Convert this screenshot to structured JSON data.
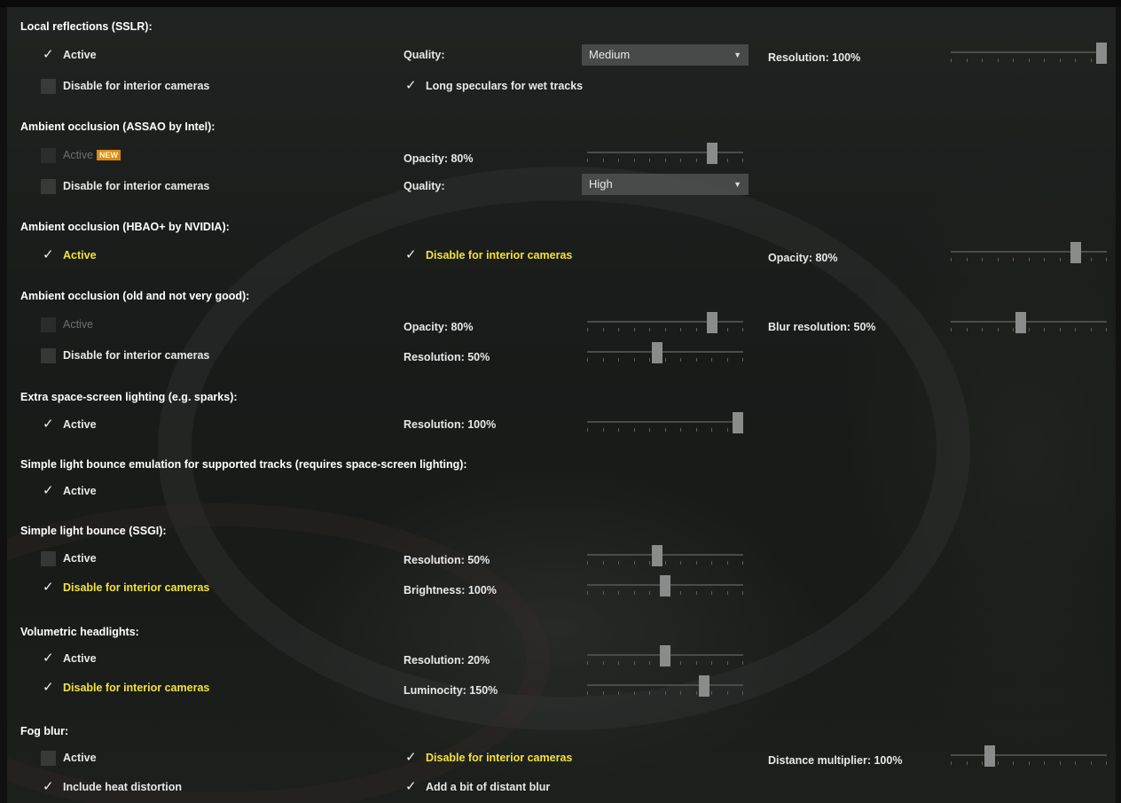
{
  "sections": {
    "sslr": {
      "title": "Local reflections (SSLR):",
      "active": {
        "label": "Active",
        "checked": true
      },
      "disable_interior": {
        "label": "Disable for interior cameras",
        "checked": false
      },
      "quality_label": "Quality:",
      "quality_value": "Medium",
      "long_speculars": {
        "label": "Long speculars for wet tracks",
        "checked": true
      },
      "resolution": {
        "label": "Resolution: 100%",
        "value": 1.0
      }
    },
    "assao": {
      "title": "Ambient occlusion (ASSAO by Intel):",
      "active": {
        "label": "Active",
        "checked": false,
        "badge": "NEW"
      },
      "disable_interior": {
        "label": "Disable for interior cameras",
        "checked": false
      },
      "opacity": {
        "label": "Opacity: 80%",
        "value": 0.8
      },
      "quality_label": "Quality:",
      "quality_value": "High"
    },
    "hbao": {
      "title": "Ambient occlusion (HBAO+ by NVIDIA):",
      "active": {
        "label": "Active",
        "checked": true
      },
      "disable_interior": {
        "label": "Disable for interior cameras",
        "checked": true
      },
      "opacity": {
        "label": "Opacity: 80%",
        "value": 0.8
      }
    },
    "oldao": {
      "title": "Ambient occlusion (old and not very good):",
      "active": {
        "label": "Active",
        "checked": false
      },
      "disable_interior": {
        "label": "Disable for interior cameras",
        "checked": false
      },
      "opacity": {
        "label": "Opacity: 80%",
        "value": 0.8
      },
      "blur_resolution": {
        "label": "Blur resolution: 50%",
        "value": 0.45
      },
      "resolution": {
        "label": "Resolution: 50%",
        "value": 0.45
      }
    },
    "extra": {
      "title": "Extra space-screen lighting (e.g. sparks):",
      "active": {
        "label": "Active",
        "checked": true
      },
      "resolution": {
        "label": "Resolution: 100%",
        "value": 1.0
      }
    },
    "bounce_emul": {
      "title": "Simple light bounce emulation for supported tracks (requires space-screen lighting):",
      "active": {
        "label": "Active",
        "checked": true
      }
    },
    "ssgi": {
      "title": "Simple light bounce (SSGI):",
      "active": {
        "label": "Active",
        "checked": false
      },
      "disable_interior": {
        "label": "Disable for interior cameras",
        "checked": true
      },
      "resolution": {
        "label": "Resolution: 50%",
        "value": 0.45
      },
      "brightness": {
        "label": "Brightness: 100%",
        "value": 0.5
      }
    },
    "volumetric": {
      "title": "Volumetric headlights:",
      "active": {
        "label": "Active",
        "checked": true
      },
      "disable_interior": {
        "label": "Disable for interior cameras",
        "checked": true
      },
      "resolution": {
        "label": "Resolution: 20%",
        "value": 0.5
      },
      "luminocity": {
        "label": "Luminocity: 150%",
        "value": 0.75
      }
    },
    "fog": {
      "title": "Fog blur:",
      "active": {
        "label": "Active",
        "checked": false
      },
      "heat": {
        "label": "Include heat distortion",
        "checked": true
      },
      "disable_interior": {
        "label": "Disable for interior cameras",
        "checked": true
      },
      "distant_blur": {
        "label": "Add a bit of distant blur",
        "checked": true
      },
      "distance": {
        "label": "Distance multiplier: 100%",
        "value": 0.25
      }
    }
  },
  "colors": {
    "highlight": "#f2e23a",
    "badge": "#d98a12"
  }
}
